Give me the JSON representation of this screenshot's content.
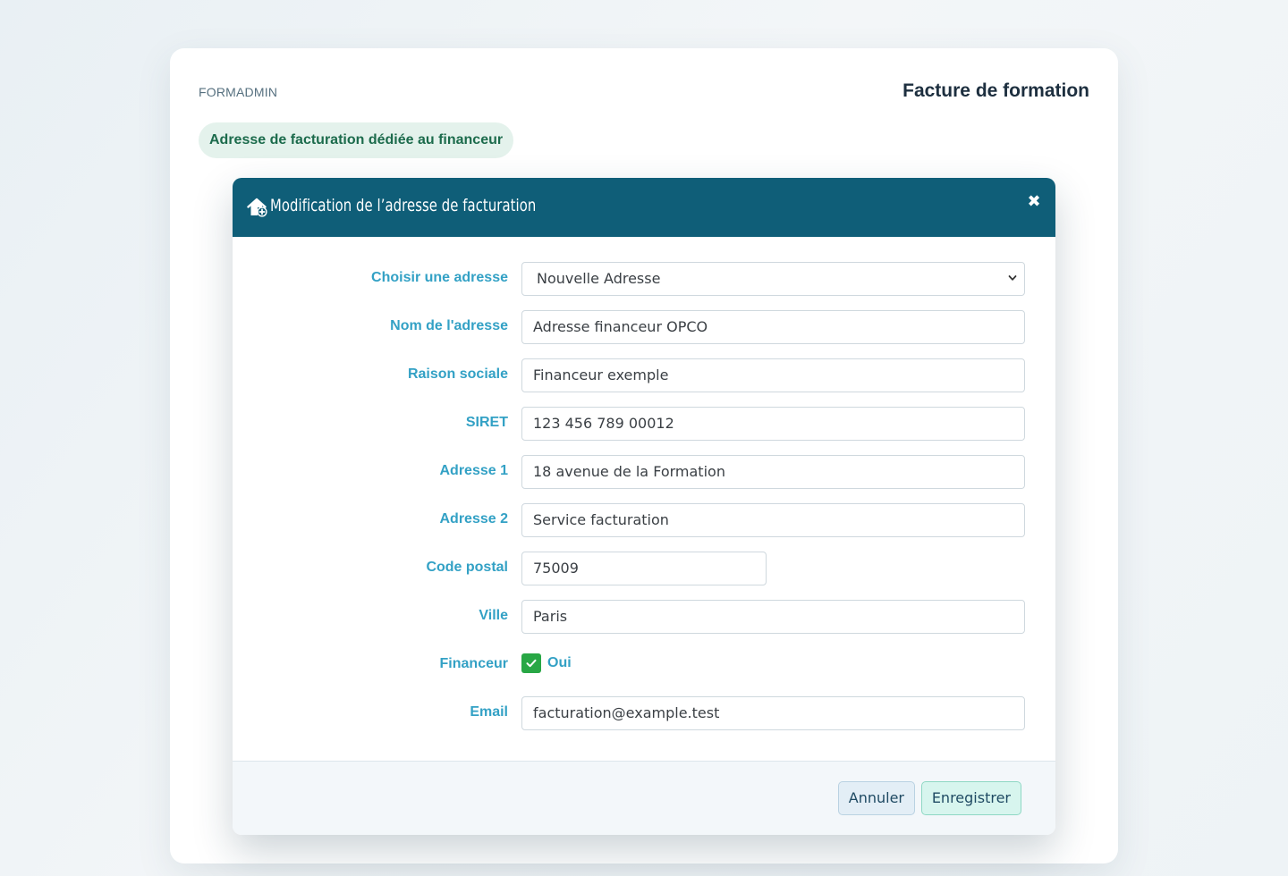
{
  "app": {
    "brand": "FORMADMIN",
    "page_title": "Facture de formation",
    "section_pill": "Adresse de facturation dédiée au financeur"
  },
  "modal": {
    "title": "Modification de l’adresse de facturation",
    "header_icon": "home-plus-icon",
    "close_icon": "close-icon",
    "close_glyph": "✖",
    "fields": {
      "choose_address": {
        "label": "Choisir une adresse",
        "value": "Nouvelle Adresse"
      },
      "address_name": {
        "label": "Nom de l'adresse",
        "value": "Adresse financeur OPCO"
      },
      "company_name": {
        "label": "Raison sociale",
        "value": "Financeur exemple"
      },
      "siret": {
        "label": "SIRET",
        "value": "123 456 789 00012"
      },
      "address1": {
        "label": "Adresse 1",
        "value": "18 avenue de la Formation"
      },
      "address2": {
        "label": "Adresse 2",
        "value": "Service facturation"
      },
      "postal_code": {
        "label": "Code postal",
        "value": "75009"
      },
      "city": {
        "label": "Ville",
        "value": "Paris"
      },
      "funder": {
        "label": "Financeur",
        "checked": true,
        "checkbox_label": "Oui"
      },
      "email": {
        "label": "Email",
        "value": "facturation@example.test"
      }
    },
    "buttons": {
      "cancel": "Annuler",
      "save": "Enregistrer"
    }
  },
  "colors": {
    "header_bg": "#0f5e78",
    "label": "#33a1c5",
    "checkbox": "#28a745",
    "pill_bg": "#e4f2ec",
    "pill_text": "#1c6b4c"
  }
}
